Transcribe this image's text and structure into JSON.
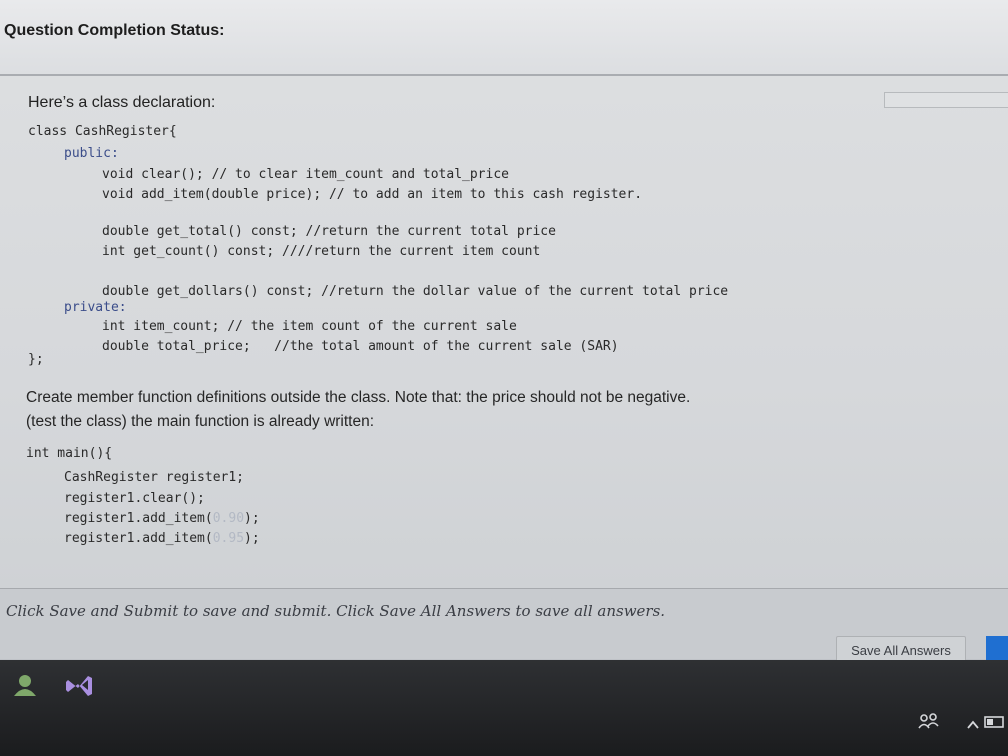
{
  "header": {
    "title": "Question Completion Status:"
  },
  "question": {
    "intro": "Here’s a class declaration:",
    "class_code": [
      "class CashRegister{",
      "public:",
      "void clear(); // to clear item_count and total_price",
      "void add_item(double price); // to add an item to this cash register.",
      "double get_total() const; //return the current total price",
      "int get_count() const; ////return the current item count",
      "double get_dollars() const; //return the dollar value of the current total price",
      "private:",
      "int item_count; // the item count of the current sale",
      "double total_price;   //the total amount of the current sale (SAR)",
      "};"
    ],
    "task_line1": "Create member function definitions outside the class. Note that: the price should not be negative.",
    "task_line2": "(test the class) the main function is already written:",
    "main_code": [
      "int main(){",
      "CashRegister register1;",
      "register1.clear();",
      "register1.add_item(",
      "0.90",
      ");",
      "register1.add_item(",
      "0.95",
      ");"
    ]
  },
  "footer": {
    "instructions": "Click Save and Submit to save and submit. Click Save All Answers to save all answers.",
    "save_all_label": "Save All Answers"
  },
  "taskbar": {
    "icons": [
      "people-icon",
      "visual-studio-icon",
      "network-icon",
      "chevron-up-icon",
      "battery-icon"
    ]
  },
  "colors": {
    "keyword": "#3b4d8a",
    "number_literal": "#b3b9c4",
    "submit_button": "#1f6fd1",
    "taskbar": "#1b1c1e"
  }
}
